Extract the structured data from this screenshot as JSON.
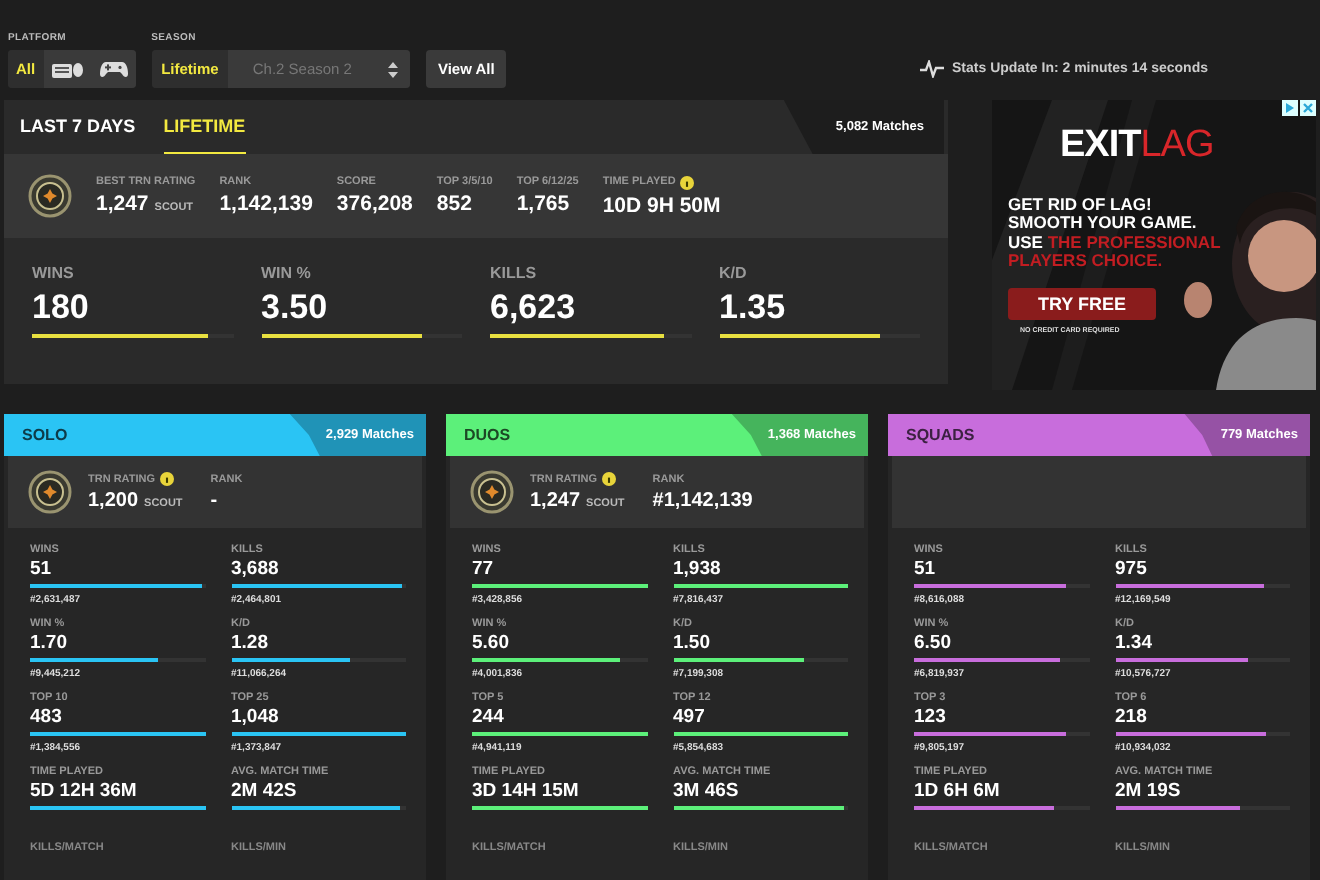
{
  "filters": {
    "platform": {
      "label": "PLATFORM",
      "options": [
        {
          "kind": "text",
          "label": "All",
          "selected": true
        },
        {
          "kind": "keyboard",
          "selected": false
        },
        {
          "kind": "gamepad",
          "selected": false
        }
      ]
    },
    "season": {
      "label": "SEASON",
      "options": [
        {
          "label": "Lifetime",
          "selected": true
        }
      ],
      "dropdown": {
        "value": "Ch.2 Season 2",
        "disabled": true
      }
    },
    "view_all": "View All"
  },
  "stats_update": "Stats Update In: 2 minutes 14 seconds",
  "overview": {
    "tabs": [
      {
        "label": "LAST 7 DAYS",
        "selected": false
      },
      {
        "label": "LIFETIME",
        "selected": true
      }
    ],
    "matches": "5,082 Matches",
    "summary": [
      {
        "label": "BEST TRN RATING",
        "value": "1,247",
        "suffix": "SCOUT"
      },
      {
        "label": "RANK",
        "value": "1,142,139"
      },
      {
        "label": "SCORE",
        "value": "376,208"
      },
      {
        "label": "TOP 3/5/10",
        "value": "852"
      },
      {
        "label": "TOP 6/12/25",
        "value": "1,765"
      },
      {
        "label": "TIME PLAYED",
        "value": "10D 9H 50M",
        "info": true
      }
    ],
    "highlights": [
      {
        "label": "WINS",
        "value": "180",
        "level": 0.88
      },
      {
        "label": "WIN %",
        "value": "3.50",
        "level": 0.8
      },
      {
        "label": "KILLS",
        "value": "6,623",
        "level": 0.87
      },
      {
        "label": "K/D",
        "value": "1.35",
        "level": 0.8
      }
    ]
  },
  "ad": {
    "logo": "EXIT",
    "logo_accent": "LAG",
    "text": "GET RID OF LAG! SMOOTH YOUR GAME. USE **THE PROFESSIONAL PLAYERS CHOICE.**",
    "button": "TRY FREE",
    "note": "NO CREDIT CARD REQUIRED"
  },
  "modes": [
    {
      "name": "SOLO",
      "color": "#2ac4f4",
      "matches": "2,929 Matches",
      "rating": {
        "label": "TRN RATING",
        "value": "1,200",
        "suffix": "SCOUT",
        "rank_label": "RANK",
        "rank": "-"
      },
      "stats": [
        {
          "label": "WINS",
          "value": "51",
          "rank": "#2,631,487",
          "level": 0.98
        },
        {
          "label": "KILLS",
          "value": "3,688",
          "rank": "#2,464,801",
          "level": 0.98
        },
        {
          "label": "WIN %",
          "value": "1.70",
          "rank": "#9,445,212",
          "level": 0.73
        },
        {
          "label": "K/D",
          "value": "1.28",
          "rank": "#11,066,264",
          "level": 0.68
        },
        {
          "label": "TOP 10",
          "value": "483",
          "rank": "#1,384,556",
          "level": 1
        },
        {
          "label": "TOP 25",
          "value": "1,048",
          "rank": "#1,373,847",
          "level": 1
        },
        {
          "label": "TIME PLAYED",
          "value": "5D 12H 36M",
          "level": 1
        },
        {
          "label": "AVG. MATCH TIME",
          "value": "2M 42S",
          "level": 0.97
        }
      ],
      "more_labels": [
        "KILLS/MATCH",
        "KILLS/MIN"
      ]
    },
    {
      "name": "DUOS",
      "color": "#5cf07a",
      "matches": "1,368 Matches",
      "rating": {
        "label": "TRN RATING",
        "value": "1,247",
        "suffix": "SCOUT",
        "rank_label": "RANK",
        "rank": "#1,142,139"
      },
      "stats": [
        {
          "label": "WINS",
          "value": "77",
          "rank": "#3,428,856",
          "level": 1
        },
        {
          "label": "KILLS",
          "value": "1,938",
          "rank": "#7,816,437",
          "level": 1
        },
        {
          "label": "WIN %",
          "value": "5.60",
          "rank": "#4,001,836",
          "level": 0.85
        },
        {
          "label": "K/D",
          "value": "1.50",
          "rank": "#7,199,308",
          "level": 0.75
        },
        {
          "label": "TOP 5",
          "value": "244",
          "rank": "#4,941,119",
          "level": 1
        },
        {
          "label": "TOP 12",
          "value": "497",
          "rank": "#5,854,683",
          "level": 1
        },
        {
          "label": "TIME PLAYED",
          "value": "3D 14H 15M",
          "level": 1
        },
        {
          "label": "AVG. MATCH TIME",
          "value": "3M 46S",
          "level": 0.98
        }
      ],
      "more_labels": [
        "KILLS/MATCH",
        "KILLS/MIN"
      ]
    },
    {
      "name": "SQUADS",
      "color": "#c86ddc",
      "matches": "779 Matches",
      "stats": [
        {
          "label": "WINS",
          "value": "51",
          "rank": "#8,616,088",
          "level": 0.87
        },
        {
          "label": "KILLS",
          "value": "975",
          "rank": "#12,169,549",
          "level": 0.85
        },
        {
          "label": "WIN %",
          "value": "6.50",
          "rank": "#6,819,937",
          "level": 0.83
        },
        {
          "label": "K/D",
          "value": "1.34",
          "rank": "#10,576,727",
          "level": 0.76
        },
        {
          "label": "TOP 3",
          "value": "123",
          "rank": "#9,805,197",
          "level": 0.87
        },
        {
          "label": "TOP 6",
          "value": "218",
          "rank": "#10,934,032",
          "level": 0.86
        },
        {
          "label": "TIME PLAYED",
          "value": "1D 6H 6M",
          "level": 0.8
        },
        {
          "label": "AVG. MATCH TIME",
          "value": "2M 19S",
          "level": 0.71
        }
      ],
      "more_labels": [
        "KILLS/MATCH",
        "KILLS/MIN"
      ]
    }
  ]
}
